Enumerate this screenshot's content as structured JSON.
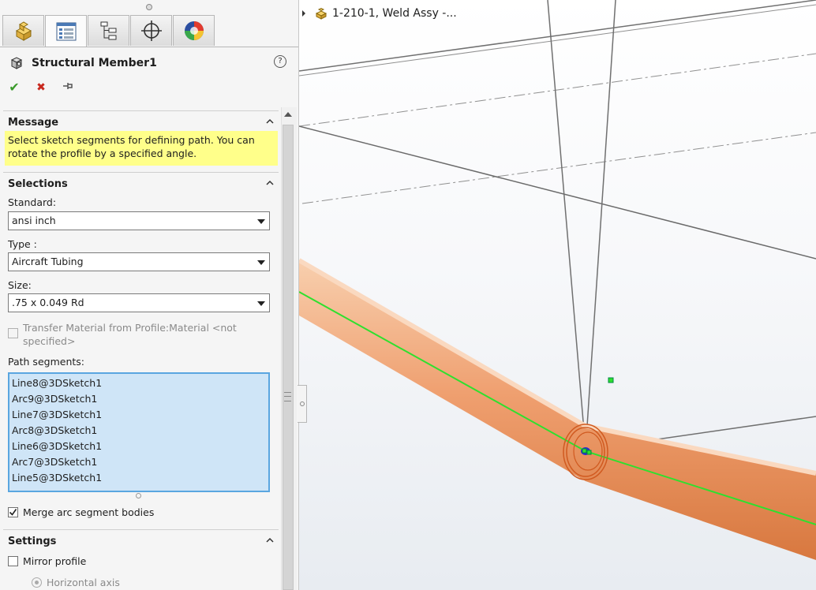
{
  "feature": {
    "title": "Structural Member1",
    "help": "?"
  },
  "tabs": [
    "feature-manager",
    "property-manager",
    "configuration-manager",
    "dimxpert-manager",
    "display-manager"
  ],
  "actions": {
    "ok": "✔",
    "cancel": "✖",
    "pin": "⊣"
  },
  "message": {
    "heading": "Message",
    "text": "Select sketch segments for defining path. You can rotate the profile by a specified angle."
  },
  "selections": {
    "heading": "Selections",
    "standard_label": "Standard:",
    "standard_value": "ansi inch",
    "type_label": "Type :",
    "type_value": "Aircraft Tubing",
    "size_label": "Size:",
    "size_value": ".75 x 0.049 Rd",
    "transfer_material_label": "Transfer Material from Profile:Material <not specified>",
    "path_segments_label": "Path segments:",
    "path_segments": [
      "Line8@3DSketch1",
      "Arc9@3DSketch1",
      "Line7@3DSketch1",
      "Arc8@3DSketch1",
      "Line6@3DSketch1",
      "Arc7@3DSketch1",
      "Line5@3DSketch1"
    ],
    "merge_arc_label": "Merge arc segment bodies",
    "merge_arc_checked": true
  },
  "settings": {
    "heading": "Settings",
    "mirror_profile_label": "Mirror profile",
    "horizontal_axis_label": "Horizontal axis"
  },
  "viewport": {
    "tree_label": "1-210-1, Weld Assy -...",
    "tube_color": "#f0a878",
    "path_color": "#2ee02e"
  }
}
